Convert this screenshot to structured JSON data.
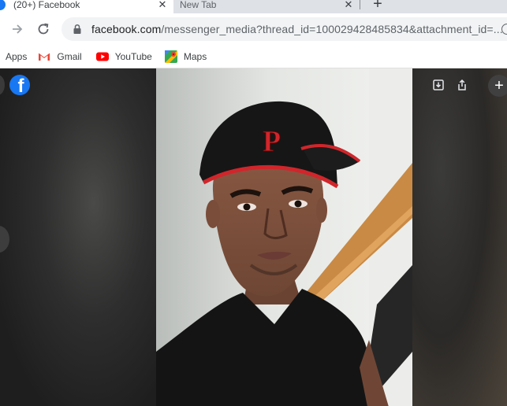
{
  "tabs": [
    {
      "title": "(20+) Facebook",
      "active": true
    },
    {
      "title": "New Tab",
      "active": false
    }
  ],
  "toolbar": {
    "url_host": "facebook.com",
    "url_path": "/messenger_media?thread_id=100029428485834&attachment_id=..."
  },
  "bookmarks": [
    {
      "label": "Apps",
      "icon": "apps-grid-icon"
    },
    {
      "label": "Gmail",
      "icon": "gmail-icon"
    },
    {
      "label": "YouTube",
      "icon": "youtube-icon"
    },
    {
      "label": "Maps",
      "icon": "maps-icon"
    }
  ],
  "viewer": {
    "logo": "f",
    "plus": "+",
    "photo_cap_letter": "P"
  },
  "colors": {
    "facebook_blue": "#1877f2",
    "tab_strip": "#dee1e6",
    "omnibox": "#f1f3f4",
    "cap_black": "#161616",
    "cap_red": "#d0262b"
  }
}
